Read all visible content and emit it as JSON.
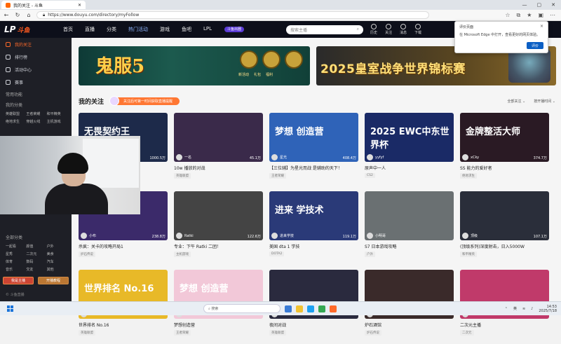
{
  "browser": {
    "tab_title": "我的关注 - 斗鱼",
    "url": "https://www.douyu.com/directory/myFollow",
    "win_controls": [
      "—",
      "▢",
      "✕"
    ]
  },
  "header": {
    "logo": "LP",
    "logo_sub": "斗鱼",
    "nav": [
      "首页",
      "直播",
      "分类",
      "热门活动",
      "游戏",
      "鱼吧",
      "LPL"
    ],
    "ad_pill": "斗鱼出圈",
    "search_placeholder": "搜索主播",
    "icons": [
      {
        "name": "history",
        "label": "历史"
      },
      {
        "name": "follow",
        "label": "关注"
      },
      {
        "name": "message",
        "label": "消息"
      },
      {
        "name": "download",
        "label": "下载"
      }
    ]
  },
  "sidebar": {
    "items": [
      {
        "label": "我的关注",
        "active": true
      },
      {
        "label": "排行榜",
        "active": false
      },
      {
        "label": "活动中心",
        "active": false
      },
      {
        "label": "赛事",
        "active": false
      }
    ],
    "sec1": "常用功能",
    "sec2": "我的分类",
    "cats1": [
      "英雄联盟",
      "王者荣耀",
      "和平精英",
      "绝地求生",
      "穿越火线",
      "主机游戏"
    ],
    "sec3": "全部分类",
    "cats2": [
      "一起看",
      "颜值",
      "户外",
      "星秀",
      "二次元",
      "美食",
      "体育",
      "数码",
      "汽车",
      "音乐",
      "交友",
      "其他"
    ],
    "btn1": "我是主播",
    "btn2": "开播教程",
    "footer": "© 斗鱼直播"
  },
  "banners": {
    "b1_title": "鬼服5",
    "b1_labels": [
      "新活动",
      "礼包",
      "福利"
    ],
    "b2_title": "2025皇室战争世界锦标赛"
  },
  "section": {
    "title": "我的关注",
    "promo": "关注后可第一时间获取直播提醒",
    "filters": [
      "全部关注 ⌄",
      "按开播时间 ⌄"
    ]
  },
  "cards": [
    {
      "title": "Ten 星落的对战",
      "tag": "英雄联盟",
      "nick": "星落",
      "hot": "1000.5万",
      "bg": "#1d2a4a",
      "big": "无畏契约王"
    },
    {
      "title": "10w 播放的对战",
      "tag": "英雄联盟",
      "nick": "一名",
      "hot": "45.1万",
      "bg": "#3a2a4a",
      "big": ""
    },
    {
      "title": "【三位辅】为星光而战 是辅助的天下！",
      "tag": "王者荣耀",
      "nick": "星光",
      "hot": "408.4万",
      "bg": "#2f63b8",
      "big": "梦想 创造营"
    },
    {
      "title": "原声中一人",
      "tag": "CS2",
      "nick": "yyfyf",
      "hot": "",
      "bg": "#1a2a66",
      "big": "2025 EWC中东世界杯"
    },
    {
      "title": "SS 能力的爱好者",
      "tag": "绝地求生",
      "nick": "xCky",
      "hot": "374.7万",
      "bg": "#2a1a24",
      "big": "金牌整活大师"
    },
    {
      "title": "杀疯：关卡的攻略开局1",
      "tag": "炉石传说",
      "nick": "小布",
      "hot": "238.8万",
      "bg": "#3b2a6a",
      "big": ""
    },
    {
      "title": "专业：下午 Ratki 二团！",
      "tag": "主机游戏",
      "nick": "Ratki",
      "hot": "122.6万",
      "bg": "#444444",
      "big": ""
    },
    {
      "title": "美国 dta 1 学技",
      "tag": "DOTA2",
      "nick": "进来学技",
      "hot": "119.1万",
      "bg": "#2a3a78",
      "big": "进来 学技术"
    },
    {
      "title": "S7 日本游戏攻略",
      "tag": "户外",
      "nick": "小明哥",
      "hot": "",
      "bg": "#6a7072",
      "big": ""
    },
    {
      "title": "(顶级系列)深度射击，日入5000W",
      "tag": "和平精英",
      "nick": "顶级",
      "hot": "107.1万",
      "bg": "#2a2e3a",
      "big": ""
    },
    {
      "title": "世界排名 No.16",
      "tag": "英雄联盟",
      "nick": "",
      "hot": "",
      "bg": "#e8b928",
      "big": "世界排名 No.16"
    },
    {
      "title": "梦想创造营",
      "tag": "王者荣耀",
      "nick": "",
      "hot": "",
      "bg": "#f2c8d8",
      "big": "梦想 创造营"
    },
    {
      "title": "夜间对战",
      "tag": "英雄联盟",
      "nick": "",
      "hot": "",
      "bg": "#2a2a3e",
      "big": ""
    },
    {
      "title": "炉石酒馆",
      "tag": "炉石传说",
      "nick": "",
      "hot": "",
      "bg": "#3a2a2a",
      "big": ""
    },
    {
      "title": "二次元主播",
      "tag": "二次元",
      "nick": "",
      "hot": "",
      "bg": "#c03a6a",
      "big": ""
    }
  ],
  "popup": {
    "title": "评价页面",
    "body": "在 Microsoft Edge 中打开，查看更好的网页体验。",
    "btn": "评价",
    "close": "×"
  },
  "taskbar": {
    "search": "搜索",
    "lang": "英",
    "time": "14:53",
    "date": "2025/7/18"
  }
}
